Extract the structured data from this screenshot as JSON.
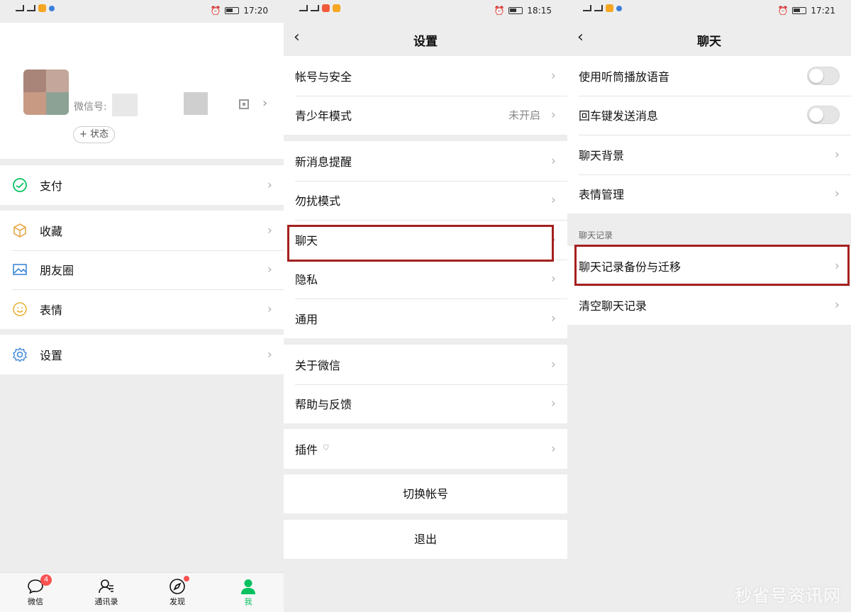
{
  "panel1": {
    "status": {
      "time": "17:20"
    },
    "profile": {
      "wechat_id_label": "微信号:",
      "status_button": "+ 状态"
    },
    "menu": {
      "pay": "支付",
      "favorites": "收藏",
      "moments": "朋友圈",
      "stickers": "表情",
      "settings": "设置"
    },
    "tabs": [
      {
        "label": "微信",
        "badge": "4"
      },
      {
        "label": "通讯录"
      },
      {
        "label": "发现"
      },
      {
        "label": "我"
      }
    ]
  },
  "panel2": {
    "status": {
      "time": "18:15"
    },
    "title": "设置",
    "items": {
      "account_security": "帐号与安全",
      "teen_mode": "青少年模式",
      "teen_mode_value": "未开启",
      "new_message": "新消息提醒",
      "do_not_disturb": "勿扰模式",
      "chat": "聊天",
      "privacy": "隐私",
      "general": "通用",
      "about": "关于微信",
      "help": "帮助与反馈",
      "plugins": "插件"
    },
    "switch_account": "切换帐号",
    "logout": "退出"
  },
  "panel3": {
    "status": {
      "time": "17:21"
    },
    "title": "聊天",
    "items": {
      "earpiece": "使用听筒播放语音",
      "enter_send": "回车键发送消息",
      "background": "聊天背景",
      "sticker_manage": "表情管理",
      "section_history": "聊天记录",
      "backup": "聊天记录备份与迁移",
      "clear": "清空聊天记录"
    },
    "toggles": {
      "earpiece": false,
      "enter_send": false
    }
  },
  "watermark": "秒省号资讯网",
  "colors": {
    "accent": "#07c160",
    "highlight": "#a3201e",
    "badge": "#fa5151"
  }
}
